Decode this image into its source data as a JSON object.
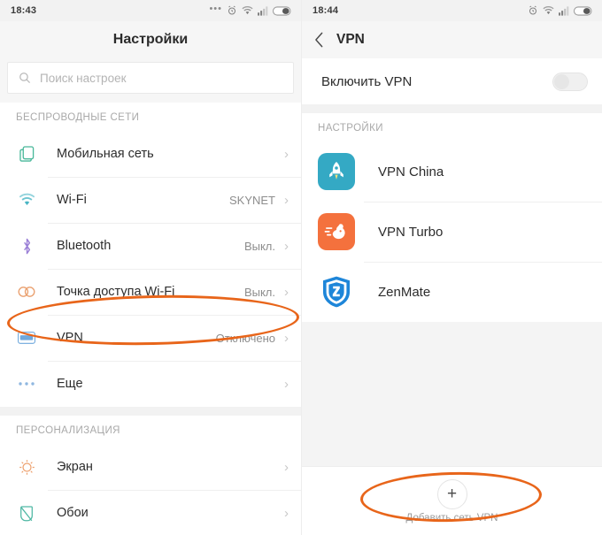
{
  "left_screen": {
    "statusbar": {
      "time": "18:43",
      "icons": [
        "dots-icon",
        "alarm-icon",
        "wifi-icon",
        "signal-icon",
        "battery-icon"
      ]
    },
    "header": {
      "title": "Настройки"
    },
    "search": {
      "placeholder": "Поиск настроек",
      "icon": "search-icon"
    },
    "sections": [
      {
        "label": "БЕСПРОВОДНЫЕ СЕТИ",
        "rows": [
          {
            "icon": "sim-card-icon",
            "label": "Мобильная сеть",
            "value": "",
            "chevron": "›"
          },
          {
            "icon": "wifi-icon",
            "label": "Wi-Fi",
            "value": "SKYNET",
            "chevron": "›"
          },
          {
            "icon": "bluetooth-icon",
            "label": "Bluetooth",
            "value": "Выкл.",
            "chevron": "›"
          },
          {
            "icon": "hotspot-icon",
            "label": "Точка доступа Wi-Fi",
            "value": "Выкл.",
            "chevron": "›"
          },
          {
            "icon": "vpn-icon",
            "label": "VPN",
            "value": "Отключено",
            "chevron": "›"
          },
          {
            "icon": "more-dots-icon",
            "label": "Еще",
            "value": "",
            "chevron": "›"
          }
        ]
      },
      {
        "label": "ПЕРСОНАЛИЗАЦИЯ",
        "rows": [
          {
            "icon": "brightness-icon",
            "label": "Экран",
            "value": "",
            "chevron": "›"
          },
          {
            "icon": "wallpaper-icon",
            "label": "Обои",
            "value": "",
            "chevron": "›"
          }
        ]
      }
    ]
  },
  "right_screen": {
    "statusbar": {
      "time": "18:44",
      "icons": [
        "alarm-icon",
        "wifi-icon",
        "signal-icon",
        "battery-icon"
      ]
    },
    "header": {
      "back_icon": "chevron-left-icon",
      "title": "VPN"
    },
    "enable": {
      "label": "Включить VPN",
      "toggle_state": "off"
    },
    "section_label": "НАСТРОЙКИ",
    "apps": [
      {
        "name": "VPN China",
        "icon": "rocket-icon",
        "color": "#34a9c4"
      },
      {
        "name": "VPN Turbo",
        "icon": "rabbit-icon",
        "color": "#f4713d"
      },
      {
        "name": "ZenMate",
        "icon": "shield-icon",
        "color": "#1e86d9"
      }
    ],
    "add_vpn": {
      "icon": "plus-icon",
      "symbol": "+",
      "label": "Добавить сеть VPN"
    }
  },
  "annotations": {
    "color": "#e8651a",
    "items": [
      {
        "name": "vpn-row-highlight",
        "target": "VPN"
      },
      {
        "name": "add-vpn-highlight",
        "target": "Добавить сеть VPN"
      }
    ]
  }
}
